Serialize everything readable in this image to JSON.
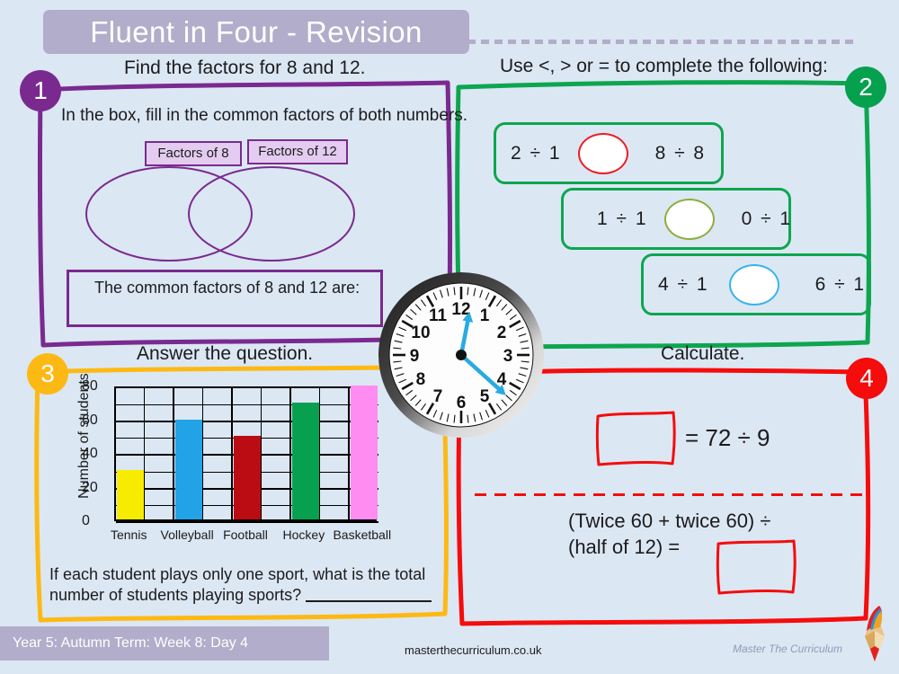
{
  "header": {
    "title": "Fluent in Four - Revision"
  },
  "sections": {
    "q1": {
      "badge": "1",
      "caption": "Find the factors for 8 and 12.",
      "instruction": "In the box, fill in the common factors of both numbers.",
      "venn_label_left": "Factors of 8",
      "venn_label_right": "Factors of 12",
      "answer_prompt": "The common factors of 8 and 12 are:",
      "color": "#7a2a8f"
    },
    "q2": {
      "badge": "2",
      "caption": "Use <, > or = to complete the following:",
      "color": "#0da64f",
      "rows": [
        {
          "left": "2  ÷  1",
          "right": "8  ÷  8",
          "oval_color": "#ee1c24"
        },
        {
          "left": "1  ÷  1",
          "right": "0  ÷  1",
          "oval_color": "#8cae3c"
        },
        {
          "left": "4  ÷  1",
          "right": "6  ÷  1",
          "oval_color": "#36b4ec"
        }
      ]
    },
    "q3": {
      "badge": "3",
      "caption": "Answer the question.",
      "question_line1": "If each student plays only one sport, what is the total",
      "question_line2": "number of students playing sports?",
      "answer_value": "",
      "color": "#fdb913"
    },
    "q4": {
      "badge": "4",
      "caption": "Calculate.",
      "equation_1": "= 72 ÷ 9",
      "equation_2_line1": "(Twice 60 + twice 60) ÷",
      "equation_2_line2": "(half of 12) =",
      "box_1_value": "",
      "box_2_value": "",
      "color": "#f50c0c"
    }
  },
  "chart_data": {
    "type": "bar",
    "title": "",
    "xlabel": "",
    "ylabel": "Number of students",
    "categories": [
      "Tennis",
      "Volleyball",
      "Football",
      "Hockey",
      "Basketball"
    ],
    "values": [
      30,
      60,
      50,
      70,
      80
    ],
    "bar_colors": [
      "#f7ec00",
      "#22a3e8",
      "#ba0c12",
      "#07a04f",
      "#ff8cf0"
    ],
    "ylim": [
      0,
      80
    ],
    "yticks": [
      0,
      20,
      40,
      60,
      80
    ],
    "grid": true,
    "legend": "none"
  },
  "clock": {
    "hour_numbers": [
      "12",
      "1",
      "2",
      "3",
      "4",
      "5",
      "6",
      "7",
      "8",
      "9",
      "10",
      "11"
    ],
    "hour_hand_angle": 11,
    "minute_hand_angle": 132,
    "hand_color": "#29aae1"
  },
  "footer": {
    "term_label": "Year 5: Autumn Term: Week 8: Day 4",
    "website": "masterthecurriculum.co.uk",
    "brand": "Master The Curriculum"
  }
}
